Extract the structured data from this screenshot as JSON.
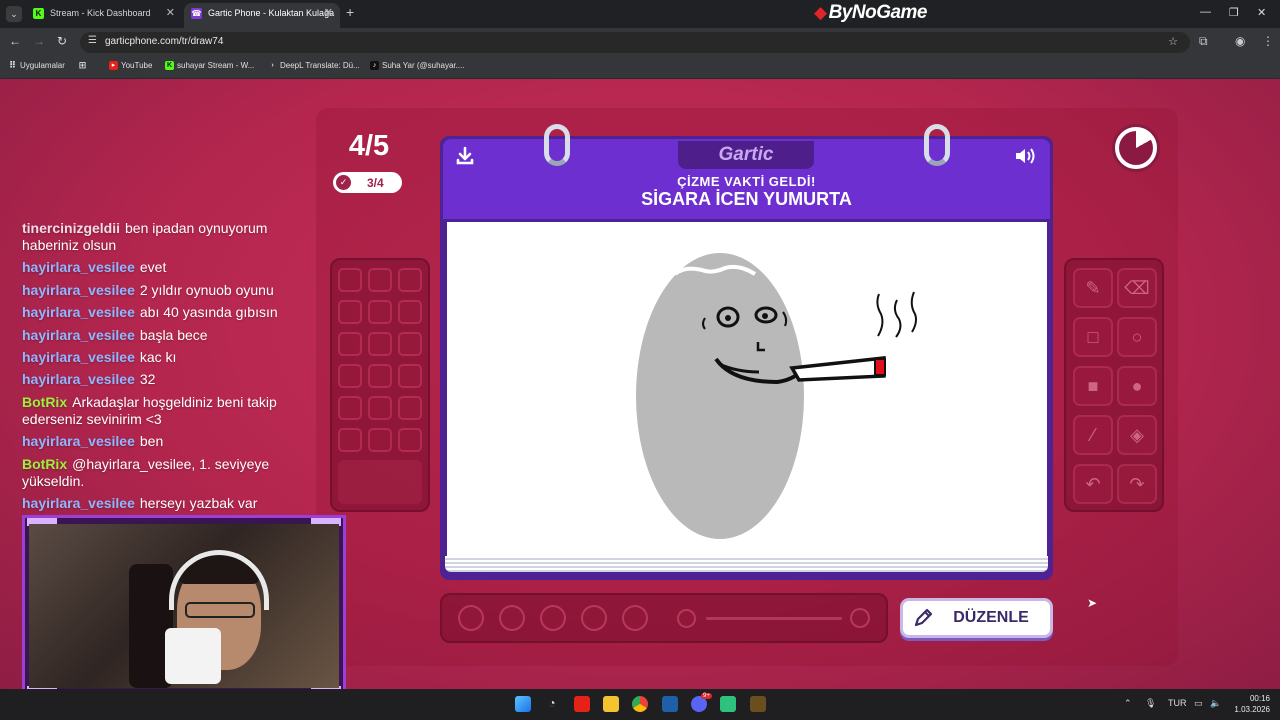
{
  "browser": {
    "tabs": [
      {
        "title": "Stream - Kick Dashboard",
        "favicon": "K",
        "active": false
      },
      {
        "title": "Gartic Phone - Kulaktan Kulağa",
        "favicon": "☎",
        "active": true
      }
    ],
    "new_tab": "+",
    "brand_watermark": "ByNoGame",
    "url": "garticphone.com/tr/draw74",
    "bookmarks": [
      {
        "label": "Uygulamalar"
      },
      {
        "label": "YouTube"
      },
      {
        "label": "suhayar Stream - W..."
      },
      {
        "label": "DeepL Translate: Dü..."
      },
      {
        "label": "Suha Yar (@suhayar...."
      }
    ]
  },
  "game": {
    "round": "4/5",
    "progress": "3/4",
    "logo": "Gartic",
    "subheading": "ÇİZME VAKTİ GELDİ!",
    "prompt": "SİGARA İCEN YUMURTA",
    "edit_button": "DÜZENLE",
    "timer_remaining_fraction": 0.83,
    "brush_sizes": 5
  },
  "chat": [
    {
      "user": "tinercinizgeldii",
      "text": "ben ipadan oynuyorum haberiniz olsun",
      "color": "#f1dbe6"
    },
    {
      "user": "hayirlara_vesilee",
      "text": "evet",
      "color": "#8fb6ff"
    },
    {
      "user": "hayirlara_vesilee",
      "text": "2 yıldır oynuob oyunu",
      "color": "#8fb6ff"
    },
    {
      "user": "hayirlara_vesilee",
      "text": "abı 40 yasında gıbısın",
      "color": "#8fb6ff"
    },
    {
      "user": "hayirlara_vesilee",
      "text": "başla bece",
      "color": "#8fb6ff"
    },
    {
      "user": "hayirlara_vesilee",
      "text": "kac kı",
      "color": "#8fb6ff"
    },
    {
      "user": "hayirlara_vesilee",
      "text": "32",
      "color": "#8fb6ff"
    },
    {
      "user": "BotRix",
      "text": "Arkadaşlar hoşgeldiniz beni takip ederseniz sevinirim <3",
      "color": "#9cf03a"
    },
    {
      "user": "hayirlara_vesilee",
      "text": "ben",
      "color": "#8fb6ff"
    },
    {
      "user": "BotRix",
      "text": "@hayirlara_vesilee, 1. seviyeye yükseldin.",
      "color": "#9cf03a"
    },
    {
      "user": "hayirlara_vesilee",
      "text": "herseyı yazbak var",
      "color": "#8fb6ff"
    }
  ],
  "taskbar": {
    "language": "TUR",
    "time": "00:16",
    "date": "1.03.2026",
    "discord_badge": "9+"
  },
  "colors": {
    "page_bg": "#b4264e",
    "book_purple": "#6d2fd0",
    "egg_gray": "#b9b9b9",
    "cigarette_tip": "#e1101d"
  }
}
